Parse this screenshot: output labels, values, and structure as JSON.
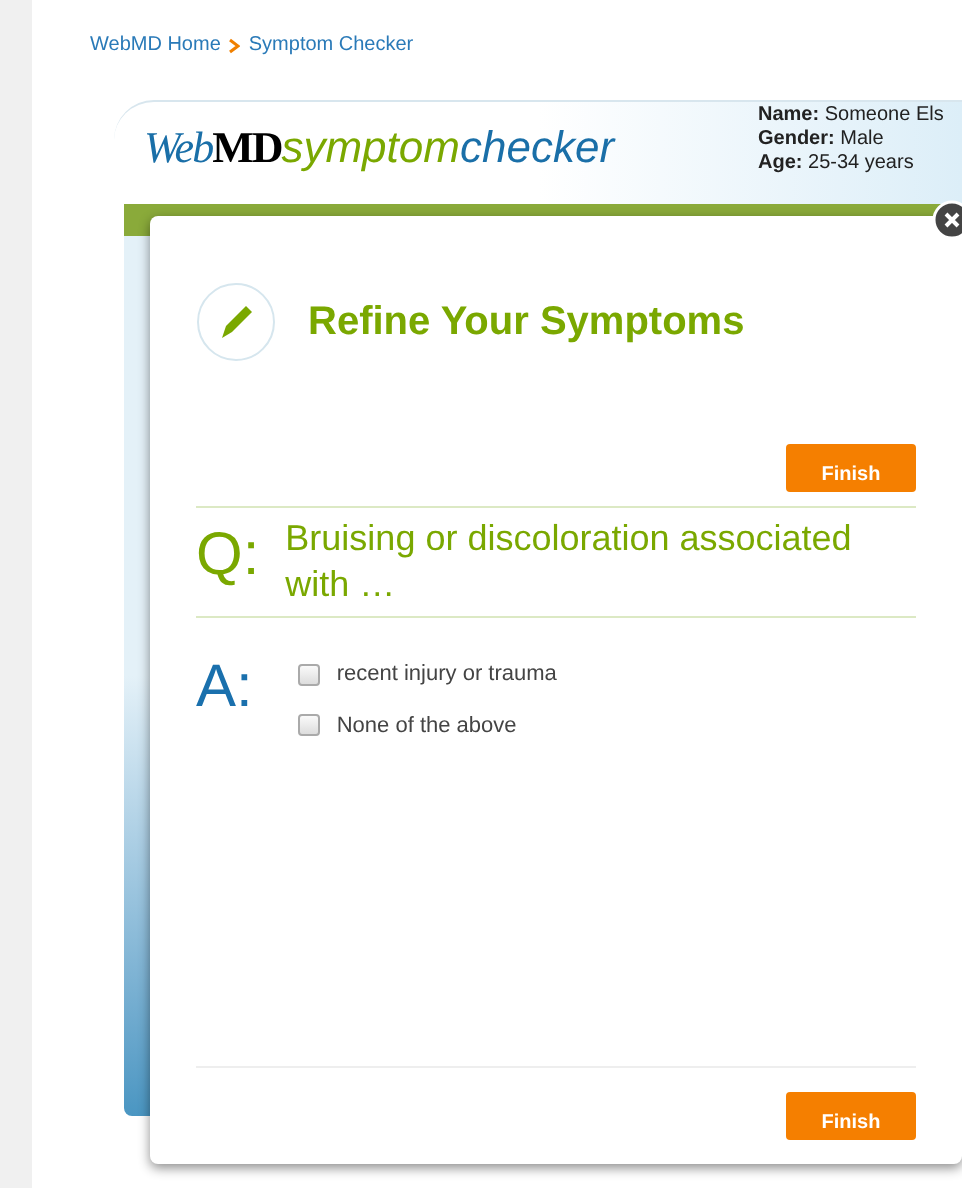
{
  "breadcrumb": [
    {
      "label": "WebMD Home"
    },
    {
      "label": "Symptom Checker"
    }
  ],
  "logo": [
    "Web",
    "MD",
    "symptom",
    "checker"
  ],
  "profile": [
    "**Name:** Someone Els",
    "**Gender:** Male",
    "**Age:** 25-34 years"
  ],
  "dialog": {
    "title": "Refine Your Symptoms",
    "finish_top": "Finish",
    "q_label": "Q:",
    "question": "Bruising or discoloration associated with …",
    "a_label": "A:",
    "answers": [
      {
        "label": "recent injury or trauma",
        "checked": false
      },
      {
        "label": "None of the above",
        "checked": false
      }
    ],
    "finish_bottom": "Finish"
  }
}
